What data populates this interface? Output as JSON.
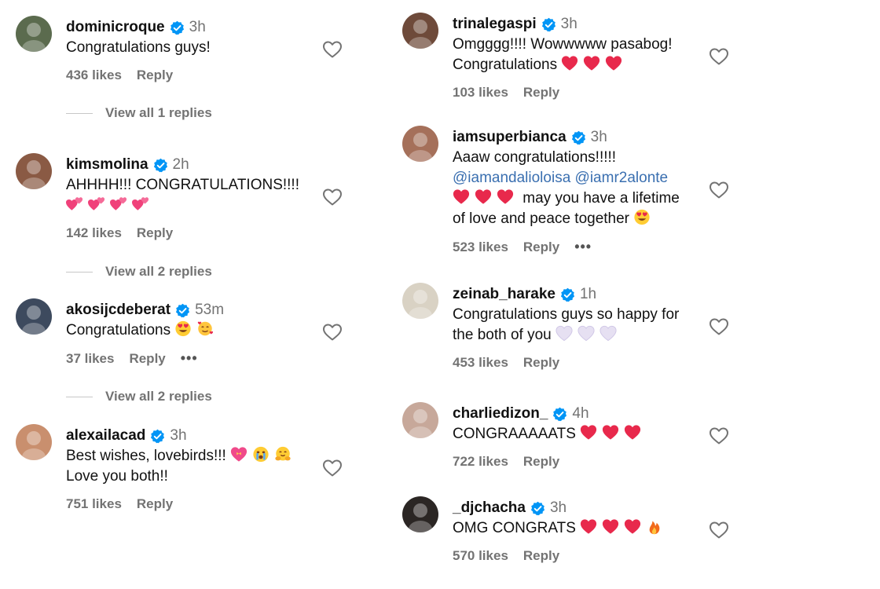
{
  "accent": "#0095f6",
  "left": [
    {
      "user": "dominicroque",
      "verified": true,
      "time": "3h",
      "lines": [
        [
          "Congratulations guys!"
        ]
      ],
      "likes": "436 likes",
      "reply": "Reply",
      "more": false,
      "view_replies": "View all 1 replies",
      "avatar_color": "#5b6b4e"
    },
    {
      "user": "kimsmolina",
      "verified": true,
      "time": "2h",
      "lines": [
        [
          "AHHHH!!! CONGRATULATIONS!!!!"
        ],
        [
          "@two-hearts",
          "@two-hearts",
          "@two-hearts",
          "@two-hearts"
        ]
      ],
      "likes": "142 likes",
      "reply": "Reply",
      "more": false,
      "view_replies": "View all 2 replies",
      "avatar_color": "#8a5a44"
    },
    {
      "user": "akosijcdeberat",
      "verified": true,
      "time": "53m",
      "lines": [
        [
          "Congratulations ",
          "@heart-eyes",
          "@smiling-hearts"
        ]
      ],
      "likes": "37 likes",
      "reply": "Reply",
      "more": true,
      "view_replies": "View all 2 replies",
      "avatar_color": "#3d4a5e"
    },
    {
      "user": "alexailacad",
      "verified": true,
      "time": "3h",
      "lines": [
        [
          "Best wishes, lovebirds!!! ",
          "@heart-ribbon",
          "@crying-face",
          "@hugging-face"
        ],
        [
          "Love you both!!"
        ]
      ],
      "likes": "751 likes",
      "reply": "Reply",
      "more": false,
      "view_replies": "",
      "avatar_color": "#c98f6e"
    }
  ],
  "right": [
    {
      "user": "trinalegaspi",
      "verified": true,
      "time": "3h",
      "lines": [
        [
          "Omgggg!!!! Wowwwww pasabog!"
        ],
        [
          "Congratulations ",
          "@red-heart",
          "@red-heart",
          "@red-heart"
        ]
      ],
      "likes": "103 likes",
      "reply": "Reply",
      "more": false,
      "avatar_color": "#6e4a3a"
    },
    {
      "user": "iamsuperbianca",
      "verified": true,
      "time": "3h",
      "lines": [
        [
          "Aaaw congratulations!!!!!"
        ],
        [
          "#@iamandalioloisa @iamr2alonte"
        ],
        [
          "@red-heart",
          "@red-heart",
          "@red-heart",
          " may you have a lifetime"
        ],
        [
          "of love and peace together ",
          "@heart-eyes"
        ]
      ],
      "likes": "523 likes",
      "reply": "Reply",
      "more": true,
      "avatar_color": "#a5705a"
    },
    {
      "user": "zeinab_harake",
      "verified": true,
      "time": "1h",
      "lines": [
        [
          "Congratulations guys so happy for"
        ],
        [
          "the both of you ",
          "@white-heart",
          "@white-heart",
          "@white-heart"
        ]
      ],
      "likes": "453 likes",
      "reply": "Reply",
      "more": false,
      "avatar_color": "#d9d2c4"
    },
    {
      "user": "charliedizon_",
      "verified": true,
      "time": "4h",
      "lines": [
        [
          "CONGRAAAAATS ",
          "@red-heart",
          "@red-heart",
          "@red-heart"
        ]
      ],
      "likes": "722 likes",
      "reply": "Reply",
      "more": false,
      "avatar_color": "#c7a89a"
    },
    {
      "user": "_djchacha",
      "verified": true,
      "time": "3h",
      "lines": [
        [
          "OMG CONGRATS ",
          "@red-heart",
          "@red-heart",
          "@red-heart",
          "@fire"
        ]
      ],
      "likes": "570 likes",
      "reply": "Reply",
      "more": false,
      "avatar_color": "#2b2624"
    }
  ]
}
